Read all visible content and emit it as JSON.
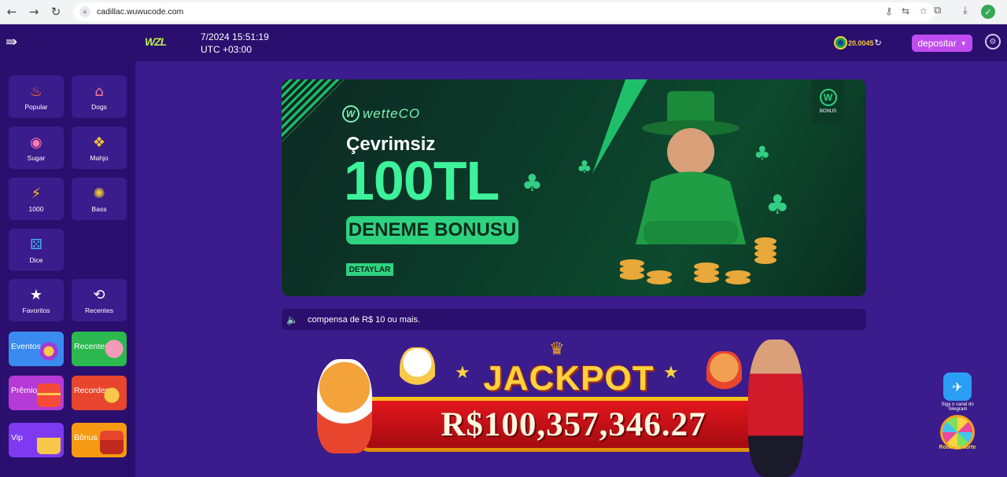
{
  "browser": {
    "url": "cadillac.wuwucode.com",
    "icons": [
      "back-icon",
      "forward-icon",
      "reload-icon",
      "password-key-icon",
      "translate-icon",
      "bookmark-star-icon",
      "extensions-icon",
      "download-icon",
      "profile-avatar-icon"
    ]
  },
  "header": {
    "logo": "WZL",
    "date": "7/2024 15:51:19",
    "timezone": "UTC +03:00",
    "balance": "20.0045",
    "deposit_label": "depositar"
  },
  "sidebar": {
    "categories": [
      {
        "label": "Popular",
        "icon": "fire-icon"
      },
      {
        "label": "Dogs",
        "icon": "doghouse-icon"
      },
      {
        "label": "Sugar",
        "icon": "candy-icon"
      },
      {
        "label": "Mahjo",
        "icon": "mahjong-icon"
      },
      {
        "label": "1000",
        "icon": "lightning-icon"
      },
      {
        "label": "Bass",
        "icon": "fish-icon"
      },
      {
        "label": "Dice",
        "icon": "dice-icon"
      },
      {
        "label": "Favoritos",
        "icon": "star-icon"
      },
      {
        "label": "Recentes",
        "icon": "history-icon"
      }
    ],
    "promos": [
      {
        "label": "Eventos",
        "color": "#3a8bf0"
      },
      {
        "label": "Recentes",
        "color": "#2ab84f"
      },
      {
        "label": "Prêmios",
        "color": "#b53ad6"
      },
      {
        "label": "Recordes",
        "color": "#e8452e"
      },
      {
        "label": "Vip",
        "color": "#7d3af0"
      },
      {
        "label": "Bônus",
        "color": "#f59a12"
      }
    ]
  },
  "banner": {
    "brand": "wetteCO",
    "headline": "Çevrimsiz",
    "amount": "100TL",
    "bonus": "DENEME BONUSU",
    "details": "DETAYLAR",
    "badge": "BONUS"
  },
  "notice": {
    "text": "compensa de R$ 10 ou mais."
  },
  "jackpot": {
    "title": "JACKPOT",
    "amount": "R$100,357,346.27"
  },
  "widgets": {
    "telegram": "Siga o canal do Telegram",
    "wheel": "Roda da sorte"
  }
}
